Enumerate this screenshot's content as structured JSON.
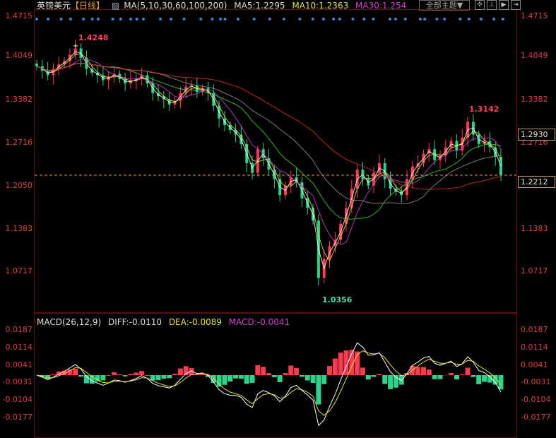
{
  "header": {
    "symbol": "英镑美元",
    "period": "【日线】",
    "ma_label": "MA(5,10,30,60,100,200)",
    "ma5": "MA5:1.2295",
    "ma10": "MA10:1.2363",
    "ma30": "MA30:1.254"
  },
  "toolbar": {
    "theme": "全部主题▼",
    "buttons": [
      "crosshair",
      "range",
      "play",
      "end"
    ]
  },
  "macd_header": {
    "label": "MACD(26,12,9)",
    "diff": "DIFF:-0.0110",
    "dea": "DEA:-0.0089",
    "macd": "MACD:-0.0041"
  },
  "colors": {
    "up": "#ff3b52",
    "down": "#2fd28a",
    "ma5": "#ffffff",
    "ma10": "#e0e040",
    "ma30": "#d040d0",
    "ma60": "#40d040",
    "ma100": "#909090",
    "ma200": "#e03030",
    "axis": "#d9404a"
  },
  "chart_data": [
    {
      "type": "candlestick",
      "ylim": [
        1.0356,
        1.4715
      ],
      "yticks": [
        "1.4715",
        "1.4049",
        "1.3382",
        "1.2716",
        "1.2050",
        "1.1383",
        "1.0717"
      ],
      "annotations": {
        "high": "1.4248",
        "low": "1.0356",
        "recent_high": "1.3142",
        "price_box": "1.2930",
        "last_box": "1.2212"
      },
      "closes": [
        1.392,
        1.385,
        1.378,
        1.388,
        1.395,
        1.4,
        1.41,
        1.42,
        1.405,
        1.388,
        1.382,
        1.378,
        1.37,
        1.376,
        1.38,
        1.372,
        1.365,
        1.37,
        1.372,
        1.378,
        1.365,
        1.35,
        1.345,
        1.34,
        1.332,
        1.338,
        1.35,
        1.36,
        1.362,
        1.352,
        1.358,
        1.35,
        1.33,
        1.31,
        1.3,
        1.292,
        1.285,
        1.27,
        1.24,
        1.225,
        1.262,
        1.248,
        1.23,
        1.215,
        1.19,
        1.205,
        1.218,
        1.21,
        1.185,
        1.17,
        1.15,
        1.06,
        1.09,
        1.11,
        1.12,
        1.145,
        1.17,
        1.2,
        1.23,
        1.215,
        1.205,
        1.225,
        1.24,
        1.215,
        1.2,
        1.195,
        1.19,
        1.215,
        1.235,
        1.24,
        1.255,
        1.262,
        1.245,
        1.252,
        1.265,
        1.275,
        1.26,
        1.28,
        1.305,
        1.285,
        1.27,
        1.275,
        1.265,
        1.25,
        1.222
      ]
    },
    {
      "type": "macd",
      "ylim": [
        -0.0177,
        0.0187
      ],
      "yticks": [
        "0.0187",
        "0.0114",
        "0.0041",
        "-0.0031",
        "-0.0104",
        "-0.0177"
      ]
    }
  ]
}
